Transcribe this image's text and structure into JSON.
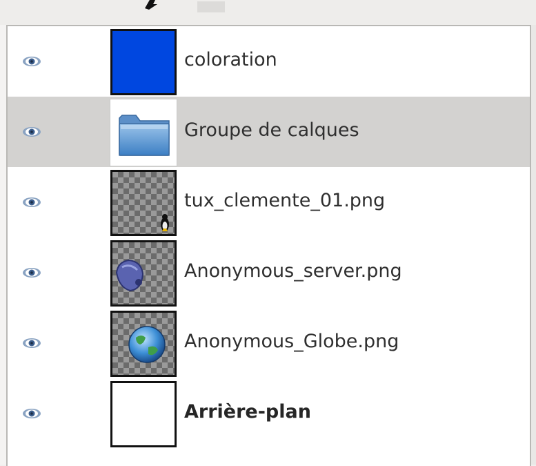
{
  "layers_panel": {
    "layers": [
      {
        "name": "coloration",
        "visible": true,
        "thumb_color": "#0047e0",
        "thumb_icon": "solid-color-thumbnail"
      },
      {
        "name": "Groupe de calques",
        "visible": true,
        "selected": true,
        "thumb_icon": "folder-icon"
      },
      {
        "name": "tux_clemente_01.png",
        "visible": true,
        "thumb_icon": "tux-penguin-thumbnail"
      },
      {
        "name": "Anonymous_server.png",
        "visible": true,
        "thumb_icon": "server-thumbnail"
      },
      {
        "name": "Anonymous_Globe.png",
        "visible": true,
        "thumb_icon": "globe-thumbnail"
      },
      {
        "name": "Arrière-plan",
        "visible": true,
        "thumb_color": "#ffffff",
        "thumb_icon": "white-background-thumbnail"
      }
    ],
    "colors": {
      "selected_row": "#d3d2d0",
      "eye_icon": "#4a6d9a"
    }
  }
}
